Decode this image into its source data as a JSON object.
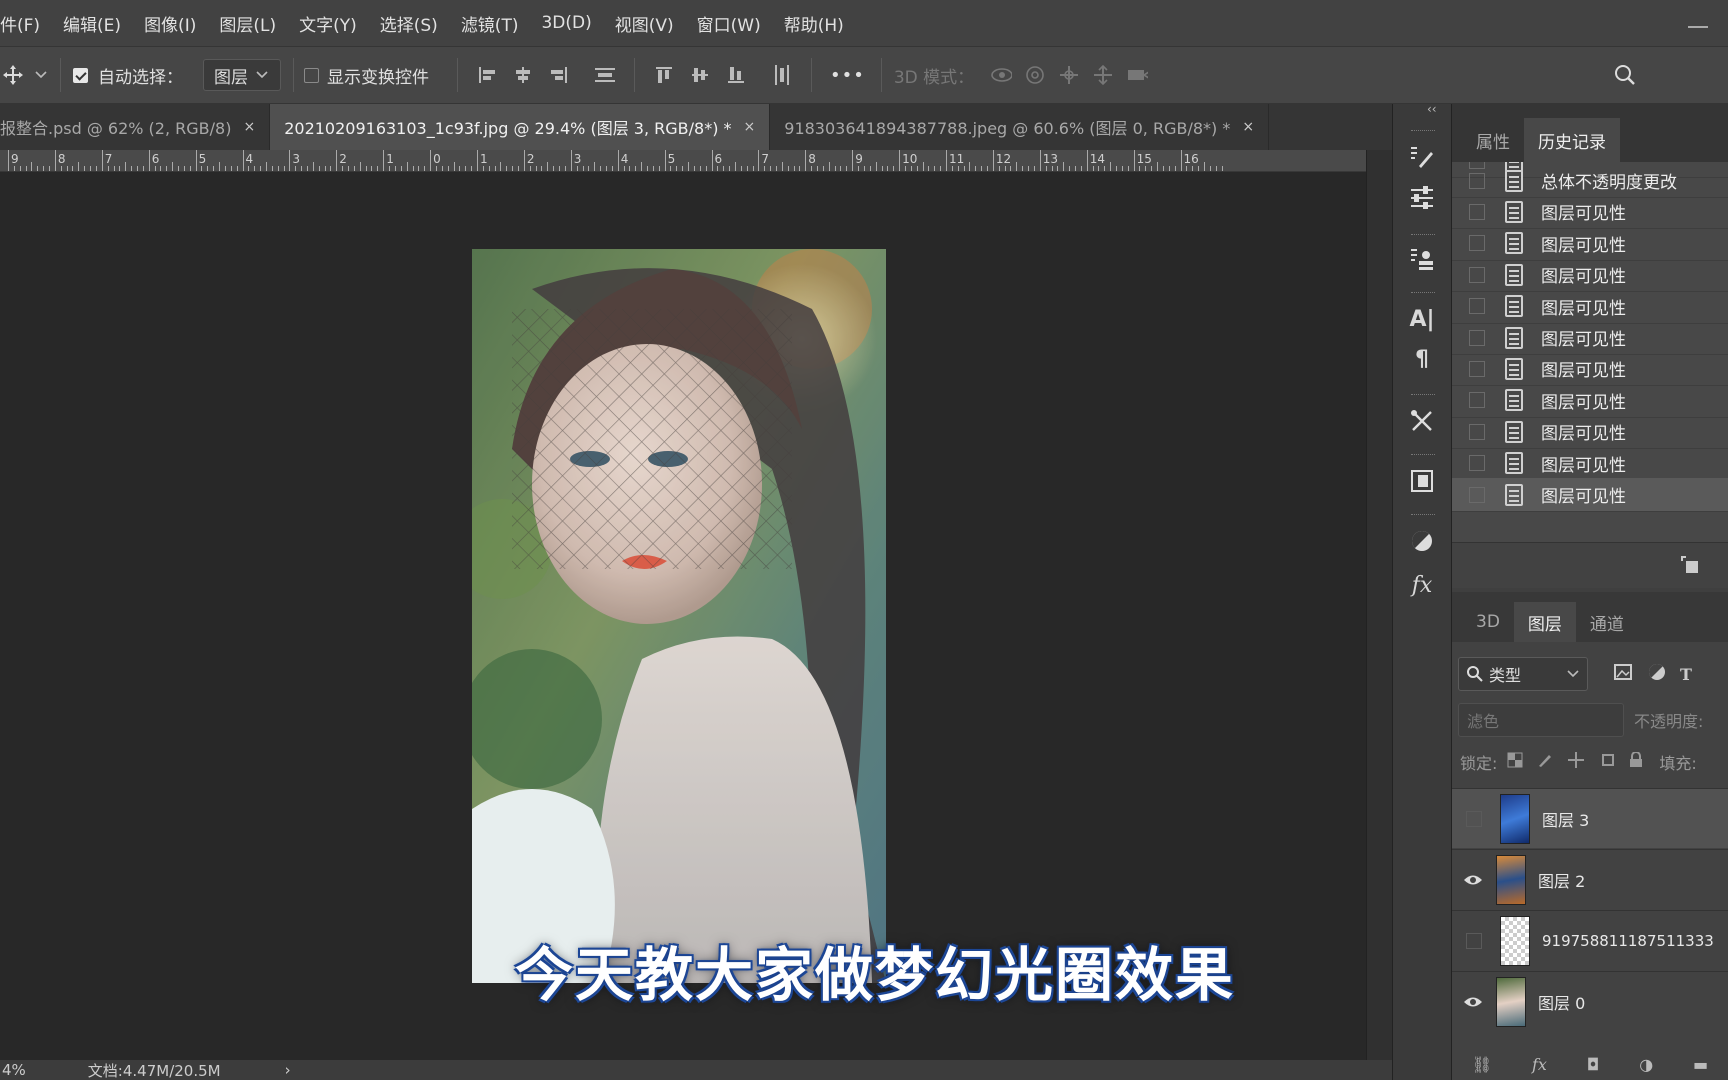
{
  "menu": [
    "件(F)",
    "编辑(E)",
    "图像(I)",
    "图层(L)",
    "文字(Y)",
    "选择(S)",
    "滤镜(T)",
    "3D(D)",
    "视图(V)",
    "窗口(W)",
    "帮助(H)"
  ],
  "options": {
    "auto_select_label": "自动选择：",
    "auto_select_target": "图层",
    "show_transform_label": "显示变换控件",
    "more": "•••",
    "mode_3d_label": "3D 模式："
  },
  "tabs": [
    {
      "label": "报整合.psd @ 62% (2, RGB/8)",
      "close": "×"
    },
    {
      "label": "20210209163103_1c93f.jpg @ 29.4% (图层 3, RGB/8*) *",
      "close": "×"
    },
    {
      "label": "918303641894387788.jpeg @ 60.6% (图层 0, RGB/8*) *",
      "close": "×"
    }
  ],
  "ruler": [
    "9",
    "8",
    "7",
    "6",
    "5",
    "4",
    "3",
    "2",
    "1",
    "0",
    "1",
    "2",
    "3",
    "4",
    "5",
    "6",
    "7",
    "8",
    "9",
    "10",
    "11",
    "12",
    "13",
    "14",
    "15",
    "16"
  ],
  "subtitle": "今天教大家做梦幻光圈效果",
  "status": {
    "zoom": "4%",
    "doc": "文档:4.47M/20.5M",
    "arrow": "›"
  },
  "collapse_arrow": "‹‹",
  "history_panel": {
    "tabs": [
      "属性",
      "历史记录"
    ],
    "items": [
      "总体不透明度更改",
      "图层可见性",
      "图层可见性",
      "图层可见性",
      "图层可见性",
      "图层可见性",
      "图层可见性",
      "图层可见性",
      "图层可见性",
      "图层可见性",
      "图层可见性"
    ]
  },
  "layers_panel": {
    "tabs": [
      "3D",
      "图层",
      "通道"
    ],
    "filter_label": "类型",
    "blend_mode": "滤色",
    "opacity_label": "不透明度:",
    "lock_label": "锁定:",
    "fill_label": "填充:",
    "layers": [
      {
        "name": "图层 3",
        "visible": false
      },
      {
        "name": "图层 2",
        "visible": true
      },
      {
        "name": "919758811187511333",
        "visible": false
      },
      {
        "name": "图层 0",
        "visible": true
      }
    ]
  },
  "colors": {
    "menubar": "#424242",
    "canvas_bg": "#282828",
    "panel": "#484848",
    "accent_subtitle": "#1e4a9c"
  }
}
